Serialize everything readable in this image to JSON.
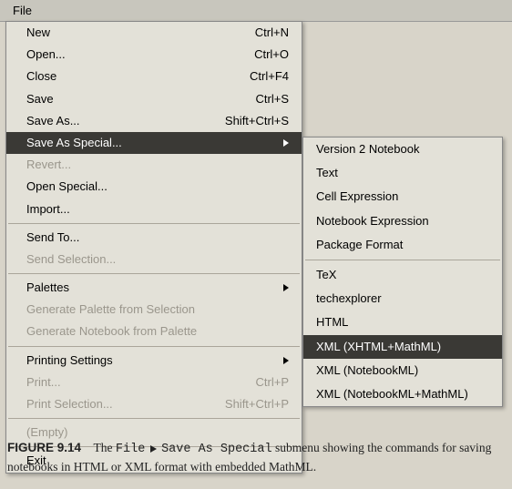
{
  "menubar": {
    "file": "File"
  },
  "menu": {
    "new": {
      "label": "New",
      "shortcut": "Ctrl+N"
    },
    "open": {
      "label": "Open...",
      "shortcut": "Ctrl+O"
    },
    "close": {
      "label": "Close",
      "shortcut": "Ctrl+F4"
    },
    "save": {
      "label": "Save",
      "shortcut": "Ctrl+S"
    },
    "saveas": {
      "label": "Save As...",
      "shortcut": "Shift+Ctrl+S"
    },
    "savespecial": {
      "label": "Save As Special..."
    },
    "revert": {
      "label": "Revert..."
    },
    "openspecial": {
      "label": "Open Special..."
    },
    "import": {
      "label": "Import..."
    },
    "sendto": {
      "label": "Send To..."
    },
    "sendsel": {
      "label": "Send Selection..."
    },
    "palettes": {
      "label": "Palettes"
    },
    "genpal": {
      "label": "Generate Palette from Selection"
    },
    "gennb": {
      "label": "Generate Notebook from Palette"
    },
    "printset": {
      "label": "Printing Settings"
    },
    "print": {
      "label": "Print...",
      "shortcut": "Ctrl+P"
    },
    "printsel": {
      "label": "Print Selection...",
      "shortcut": "Shift+Ctrl+P"
    },
    "empty": {
      "label": "(Empty)"
    },
    "exit": {
      "label": "Exit"
    }
  },
  "submenu": {
    "v2nb": "Version 2 Notebook",
    "text": "Text",
    "cellexp": "Cell Expression",
    "nbexp": "Notebook Expression",
    "pkgfmt": "Package Format",
    "tex": "TeX",
    "techx": "techexplorer",
    "html": "HTML",
    "xhtmlm": "XML (XHTML+MathML)",
    "nbml": "XML (NotebookML)",
    "nbmlm": "XML (NotebookML+MathML)"
  },
  "caption": {
    "fig": "FIGURE 9.14",
    "pre": "The ",
    "mono1": "File",
    "mono2": "Save As Special",
    "post": " submenu showing the commands for saving notebooks in HTML or XML format with embedded MathML."
  }
}
